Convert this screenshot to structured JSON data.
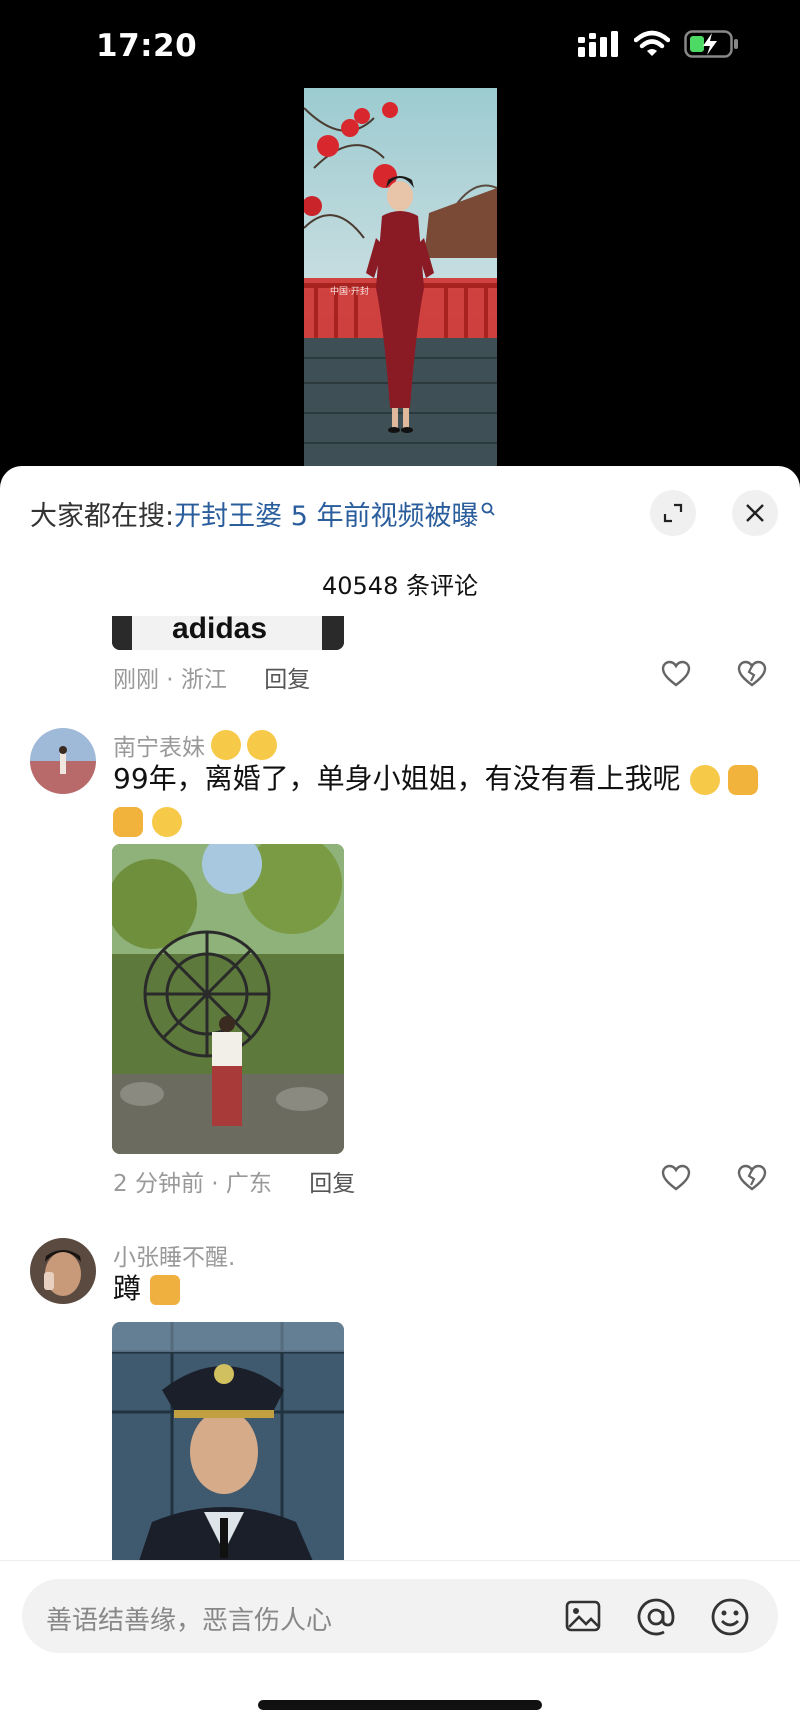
{
  "status_bar": {
    "time": "17:20"
  },
  "video": {
    "watermark": "中国·开封"
  },
  "sheet": {
    "search_prefix": "大家都在搜:",
    "search_query": "开封王婆 5 年前视频被曝",
    "comment_count": "40548 条评论"
  },
  "comments": [
    {
      "meta": "刚刚 · 浙江",
      "reply": "回复",
      "image_text": "adidas"
    },
    {
      "user": "南宁表妹",
      "text": "99年，离婚了，单身小姐姐，有没有看上我呢",
      "meta": "2 分钟前 · 广东",
      "reply": "回复"
    },
    {
      "user": "小张睡不醒.",
      "text": "蹲"
    }
  ],
  "input": {
    "placeholder": "善语结善缘，恶言伤人心"
  },
  "colors": {
    "link": "#2a5d9c",
    "muted": "#999999",
    "sheet": "#ffffff"
  }
}
